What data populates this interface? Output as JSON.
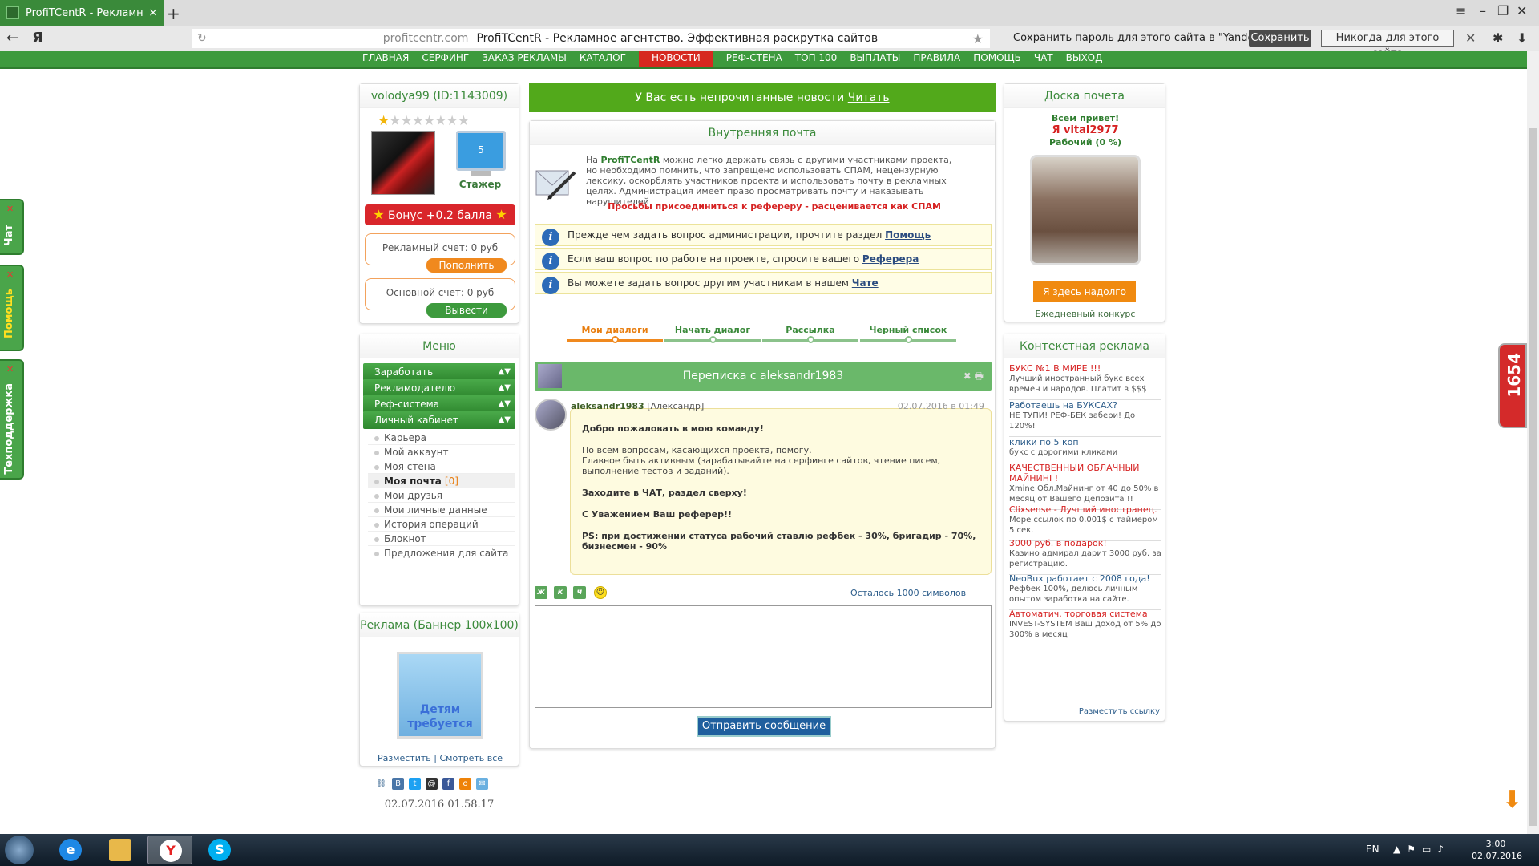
{
  "browser": {
    "tab_title": "ProfiTCentR - Рекламное",
    "tab_close": "×",
    "new_tab": "+",
    "ya_logo": "Я",
    "url_domain": "profitcentr.com",
    "page_title": "ProfiTCentR - Рекламное агентство. Эффективная раскрутка сайтов",
    "pw_prompt": "Сохранить пароль для этого сайта в \"Yandex\"?",
    "save_label": "Сохранить",
    "never_label": "Никогда для этого сайта"
  },
  "sitenav": [
    "ГЛАВНАЯ",
    "СЕРФИНГ",
    "ЗАКАЗ РЕКЛАМЫ",
    "КАТАЛОГ",
    "НОВОСТИ",
    "РЕФ-СТЕНА",
    "ТОП 100",
    "ВЫПЛАТЫ",
    "ПРАВИЛА",
    "ПОМОЩЬ",
    "ЧАТ",
    "ВЫХОД"
  ],
  "sidetabs": {
    "chat": "Чат",
    "help": "Помощь",
    "support": "Техподдержка"
  },
  "badge": "1654",
  "user": {
    "name": "volodya99 (ID:1143009)",
    "stars_total": 8,
    "stars_on": 1,
    "level": "5",
    "rank": "Стажер",
    "bonus": "Бонус +0.2 балла",
    "ad_account": "Рекламный счет: 0 руб",
    "topup_label": "Пополнить",
    "main_account": "Основной счет: 0 руб",
    "withdraw_label": "Вывести"
  },
  "menu": {
    "title": "Меню",
    "sections": [
      "Заработать",
      "Рекламодателю",
      "Реф-система",
      "Личный кабинет"
    ],
    "items": [
      "Карьера",
      "Мой аккаунт",
      "Моя стена",
      "Моя почта",
      "Мои друзья",
      "Мои личные данные",
      "История операций",
      "Блокнот",
      "Предложения для сайта"
    ],
    "mail_count": "[0]"
  },
  "banner": {
    "title": "Реклама (Баннер 100x100)",
    "image_text": "Детям требуется",
    "place": "Разместить",
    "sep": "|",
    "view_all": "Смотреть все"
  },
  "datestamp": "02.07.2016 01.58.17",
  "news": {
    "text": "У Вас есть непрочитанные новости",
    "link": "Читать"
  },
  "mail": {
    "title": "Внутренняя почта",
    "intro_pre": "На",
    "intro_brand": "ProfiTCentR",
    "intro_text": "можно легко держать связь с другими участниками проекта, но необходимо помнить, что запрещено использовать СПАМ, нецензурную лексику, оскорблять участников проекта и использовать почту в рекламных целях. Администрация имеет право просматривать почту и наказывать нарушителей",
    "intro_warn": "Просьбы присоединиться к рефереру - расценивается как СПАМ",
    "info": [
      {
        "text": "Прежде чем задать вопрос администрации, прочтите раздел",
        "link": "Помощь"
      },
      {
        "text": "Если ваш вопрос по работе на проекте, спросите вашего",
        "link": "Реферера"
      },
      {
        "text": "Вы можете задать вопрос другим участникам в нашем",
        "link": "Чате"
      }
    ],
    "tabs": [
      "Мои диалоги",
      "Начать диалог",
      "Рассылка",
      "Черный список"
    ],
    "conversation_title": "Переписка с aleksandr1983",
    "message": {
      "author": "aleksandr1983",
      "author_name": "[Александр]",
      "date": "02.07.2016 в 01:49",
      "l1": "Добро пожаловать в мою команду!",
      "l2": "По всем вопросам, касающихся проекта, помогу.",
      "l3": "Главное быть активным (зарабатывайте на серфинге сайтов, чтение писем, выполнение тестов и заданий).",
      "l4": "Заходите в ЧАТ, раздел сверху!",
      "l5": "С Уважением Ваш реферер!!",
      "l6": "PS: при достижении статуса рабочий ставлю рефбек - 30%, бригадир - 70%, бизнесмен - 90%"
    },
    "fmt": [
      "ж",
      "к",
      "ч"
    ],
    "remaining": "Осталось 1000 символов",
    "send_label": "Отправить сообщение"
  },
  "honor": {
    "title": "Доска почета",
    "hello": "Всем привет!",
    "name": "Я vital2977",
    "rank": "Рабочий (0 %)",
    "button": "Я здесь надолго",
    "daily": "Ежедневный конкурс"
  },
  "ctx": {
    "title": "Контекстная реклама",
    "ads": [
      {
        "title": "БУКС №1 В МИРЕ !!!",
        "desc": "Лучший иностранный букс всех времен и народов. Платит в $$$",
        "color": "red"
      },
      {
        "title": "Работаешь на БУКСАХ?",
        "desc": "НЕ ТУПИ! РЕФ-БЕК забери! До 120%!",
        "color": "blue"
      },
      {
        "title": "клики по 5 коп",
        "desc": "букс с дорогими кликами",
        "color": "blue"
      },
      {
        "title": "КАЧЕСТВЕННЫЙ ОБЛАЧНЫЙ МАЙНИНГ!",
        "desc": "Xmine Обл.Майнинг от 40 до 50% в месяц от Вашего Депозита !!",
        "color": "red"
      },
      {
        "title": "Clixsense - Лучший иностранец.",
        "desc": "Море ссылок по 0.001$ с таймером 5 сек.",
        "color": "red"
      },
      {
        "title": "3000 руб. в подарок!",
        "desc": "Казино адмирал дарит 3000 руб. за регистрацию.",
        "color": "red"
      },
      {
        "title": "NeoBux работает с 2008 года!",
        "desc": "Рефбек 100%, делюсь личным опытом заработка на сайте.",
        "color": "blue"
      },
      {
        "title": "Автоматич. торговая система",
        "desc": "INVEST-SYSTEM Ваш доход от 5% до 300% в месяц",
        "color": "red"
      }
    ],
    "place_link": "Разместить ссылку"
  },
  "taskbar": {
    "lang": "EN",
    "time": "3:00",
    "date": "02.07.2016"
  },
  "colors": {
    "brand_green": "#3d9a3d",
    "news_green": "#52a91b",
    "accent_orange": "#f08a10",
    "alert_red": "#d62222"
  }
}
